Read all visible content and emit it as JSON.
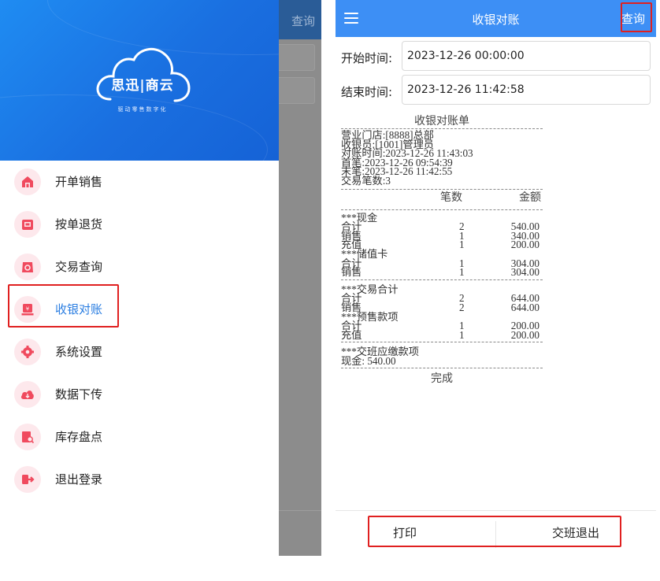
{
  "left": {
    "background": {
      "query_label": "查询"
    },
    "logo": {
      "title": "思迅|商云",
      "subtitle": "驱动零售数字化"
    },
    "menu": [
      {
        "label": "开单销售",
        "icon": "store-icon"
      },
      {
        "label": "按单退货",
        "icon": "return-order-icon"
      },
      {
        "label": "交易查询",
        "icon": "transaction-search-icon"
      },
      {
        "label": "收银对账",
        "icon": "cashier-reconcile-icon",
        "active": true
      },
      {
        "label": "系统设置",
        "icon": "gear-icon"
      },
      {
        "label": "数据下传",
        "icon": "cloud-download-icon"
      },
      {
        "label": "库存盘点",
        "icon": "inventory-check-icon"
      },
      {
        "label": "退出登录",
        "icon": "logout-icon"
      }
    ]
  },
  "right": {
    "header": {
      "title": "收银对账",
      "query_label": "查询",
      "menu_icon": "hamburger-menu-icon"
    },
    "form": {
      "start_label": "开始时间:",
      "start_value": "2023-12-26 00:00:00",
      "end_label": "结束时间:",
      "end_value": "2023-12-26 11:42:58"
    },
    "receipt": {
      "title": "收银对账单",
      "info": [
        "营业门店:[8888]总部",
        "收银员:[1001]管理员",
        "对账时间:2023-12-26 11:43:03",
        "首笔:2023-12-26 09:54:39",
        "末笔:2023-12-26 11:42:55",
        "交易笔数:3"
      ],
      "headers": {
        "count": "笔数",
        "amount": "金额"
      },
      "cash": {
        "title": "***现金",
        "rows": [
          {
            "label": "合计",
            "count": "2",
            "amount": "540.00"
          },
          {
            "label": "销售",
            "count": "1",
            "amount": "340.00"
          },
          {
            "label": "充值",
            "count": "1",
            "amount": "200.00"
          }
        ]
      },
      "stored_card": {
        "title": "***储值卡",
        "rows": [
          {
            "label": "合计",
            "count": "1",
            "amount": "304.00"
          },
          {
            "label": "销售",
            "count": "1",
            "amount": "304.00"
          }
        ]
      },
      "trade_total": {
        "title": "***交易合计",
        "rows": [
          {
            "label": "合计",
            "count": "2",
            "amount": "644.00"
          },
          {
            "label": "销售",
            "count": "2",
            "amount": "644.00"
          }
        ]
      },
      "presale": {
        "title": "***预售款项",
        "rows": [
          {
            "label": "合计",
            "count": "1",
            "amount": "200.00"
          },
          {
            "label": "充值",
            "count": "1",
            "amount": "200.00"
          }
        ]
      },
      "handover": {
        "title": "***交班应缴款项",
        "cash_line": "现金: 540.00"
      },
      "done": "完成"
    },
    "bottom": {
      "print_label": "打印",
      "handover_exit_label": "交班退出"
    }
  },
  "colors": {
    "primary_blue": "#3d8ff5",
    "drawer_blue": "#1a6fe0",
    "highlight_red": "#e02020",
    "menu_icon_red": "#f04a5e",
    "active_text": "#2a7de1"
  }
}
